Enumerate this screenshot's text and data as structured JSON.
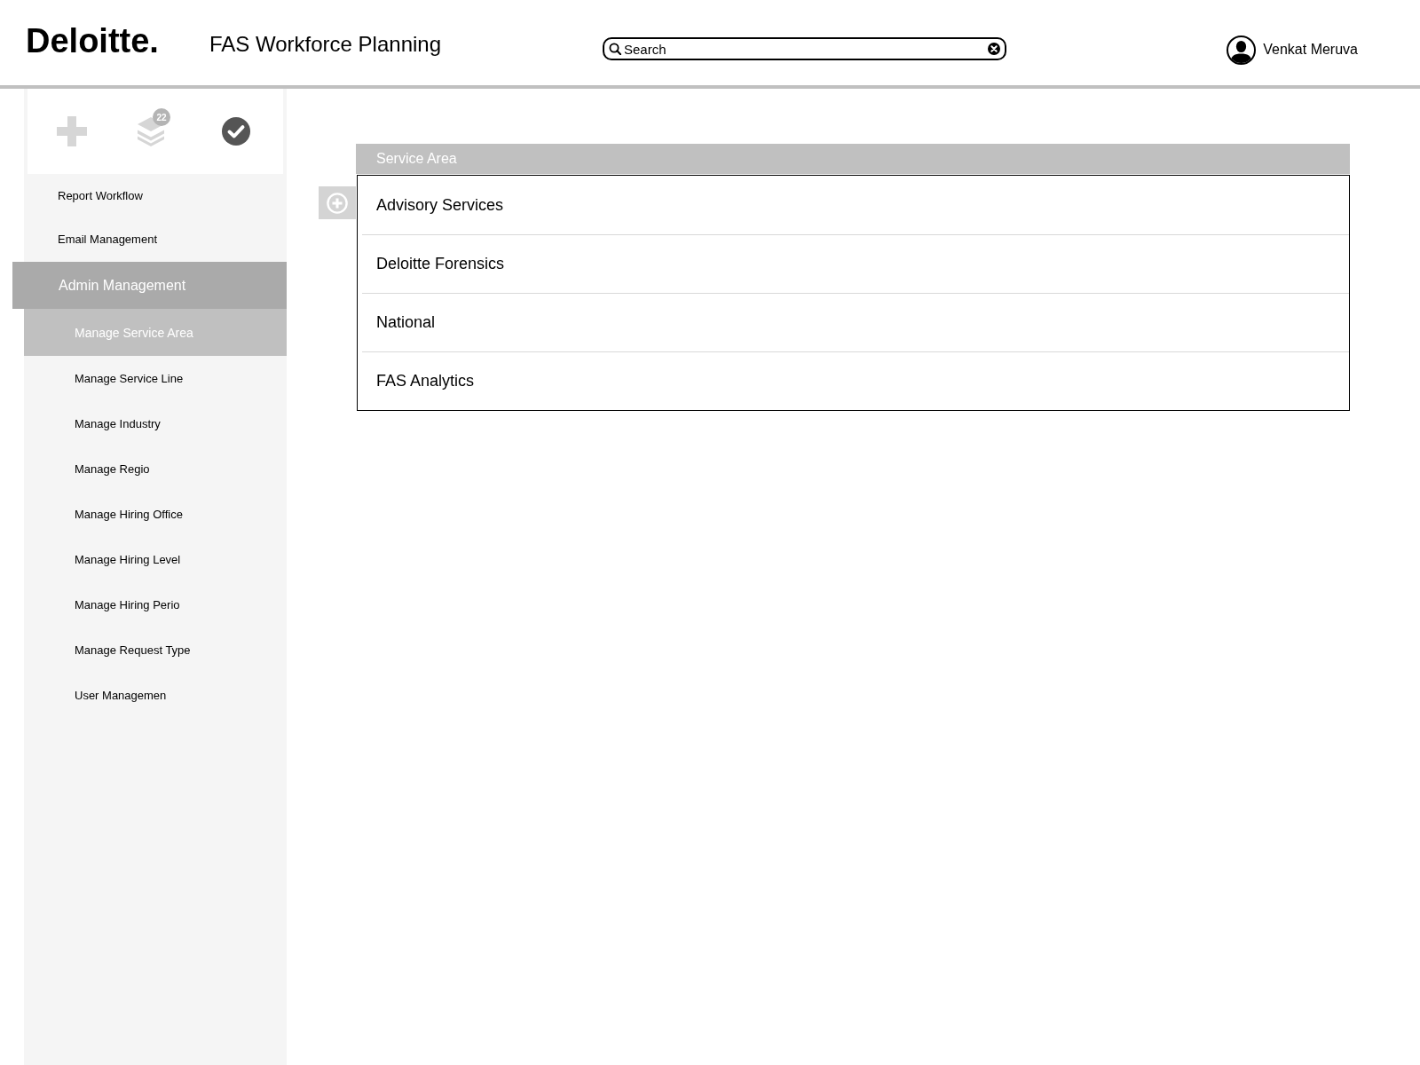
{
  "header": {
    "logo": "Deloitte.",
    "title": "FAS Workforce Planning",
    "search": {
      "placeholder": "Search"
    },
    "user": {
      "name": "Venkat Meruva"
    }
  },
  "sidebar": {
    "toolbar": [
      {
        "kind": "add",
        "disabled": true
      },
      {
        "kind": "layers",
        "disabled": true,
        "badge": "22"
      },
      {
        "kind": "approve",
        "disabled": false
      }
    ],
    "items": [
      {
        "label": "Report Workflow",
        "selected": false,
        "expanded": false
      },
      {
        "label": "Email Management",
        "selected": false,
        "expanded": false
      },
      {
        "label": "Admin Management",
        "selected": false,
        "expanded": true,
        "children": [
          {
            "label": "Manage Service Area",
            "selected": true
          },
          {
            "label": "Manage Service Line",
            "selected": false
          },
          {
            "label": "Manage Industry",
            "selected": false
          },
          {
            "label": "Manage Regio",
            "selected": false
          },
          {
            "label": "Manage Hiring Office",
            "selected": false
          },
          {
            "label": "Manage Hiring Level",
            "selected": false
          },
          {
            "label": "Manage Hiring Perio",
            "selected": false
          },
          {
            "label": "Manage Request Type",
            "selected": false
          },
          {
            "label": "User Managemen",
            "selected": false
          }
        ]
      }
    ]
  },
  "table": {
    "columns": [
      "Service Area"
    ],
    "rows": [
      [
        "Advisory Services"
      ],
      [
        "Deloitte Forensics"
      ],
      [
        "National"
      ],
      [
        "FAS Analytics"
      ]
    ]
  }
}
